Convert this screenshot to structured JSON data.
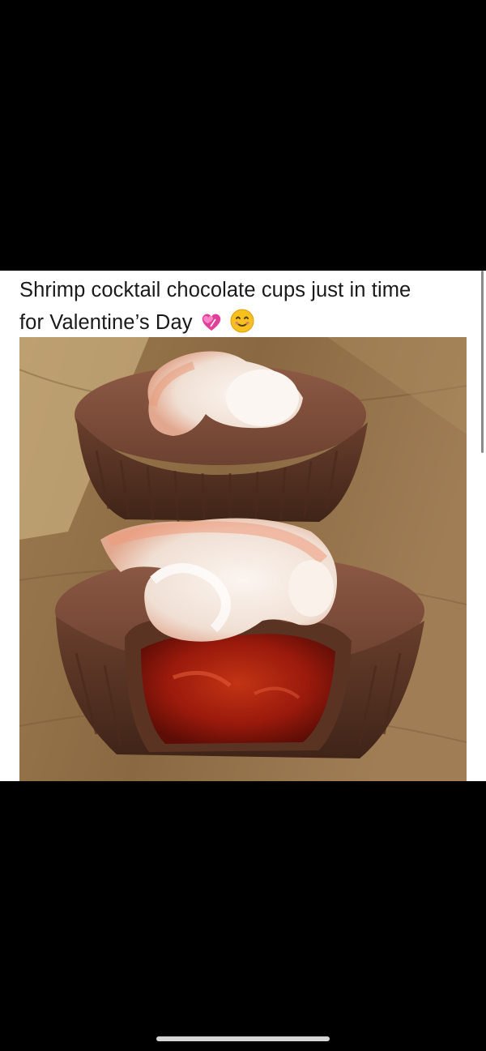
{
  "post": {
    "caption_line1": "Shrimp cocktail chocolate cups just in time",
    "caption_line2": "for Valentine’s Day",
    "emojis": [
      "revolving-hearts-icon",
      "smiling-face-icon"
    ]
  },
  "photo": {
    "subject": "chocolate-cups-with-shrimp-image"
  },
  "colors": {
    "background": "#000000",
    "card": "#ffffff",
    "text": "#1a1a1a",
    "chocolate": "#7a4a36",
    "cocktail_sauce": "#a41d0f",
    "shrimp": "#f3e6de",
    "board": "#8a6a44"
  }
}
